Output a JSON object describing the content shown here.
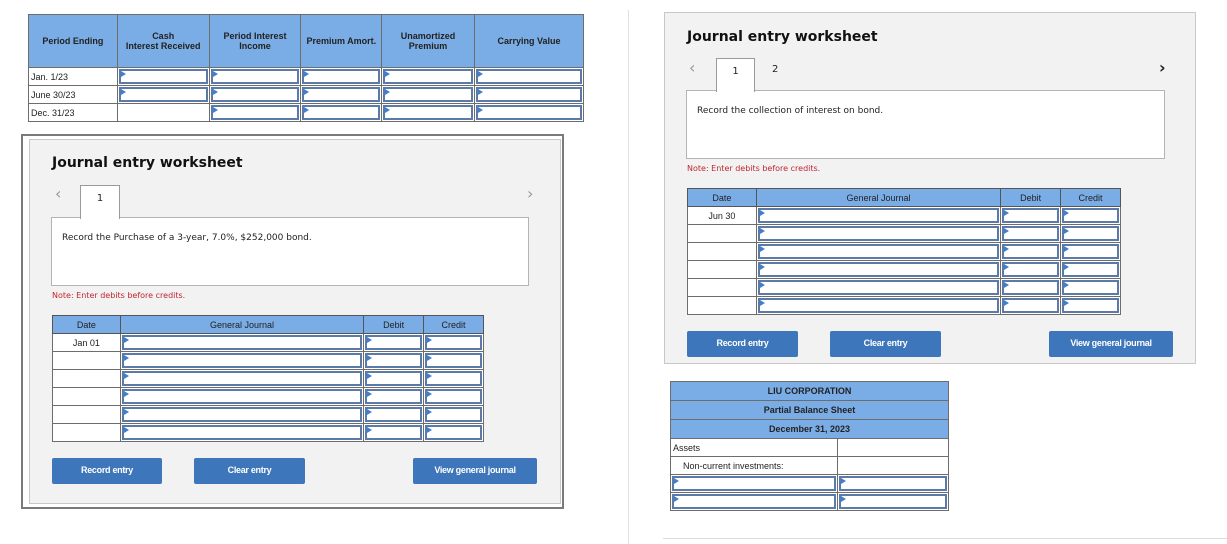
{
  "amortization_table": {
    "headers": [
      "Period Ending",
      "Cash\nInterest Received",
      "Period Interest\nIncome",
      "Premium Amort.",
      "Unamortized\nPremium",
      "Carrying Value"
    ],
    "rows": [
      {
        "period": "Jan. 1/23",
        "cash_input": true,
        "values": [
          "",
          "",
          "",
          "",
          ""
        ]
      },
      {
        "period": "June 30/23",
        "cash_input": true,
        "values": [
          "",
          "",
          "",
          "",
          ""
        ]
      },
      {
        "period": "Dec. 31/23",
        "cash_input": false,
        "values": [
          "",
          "",
          "",
          "",
          ""
        ]
      }
    ]
  },
  "worksheet_left": {
    "title": "Journal entry worksheet",
    "tabs": [
      "1"
    ],
    "active_tab": "1",
    "prompt": "Record the Purchase of a 3-year, 7.0%, $252,000 bond.",
    "note": "Note: Enter debits before credits.",
    "table_headers": [
      "Date",
      "General Journal",
      "Debit",
      "Credit"
    ],
    "rows": [
      {
        "date": "Jan 01",
        "account": "",
        "debit": "",
        "credit": ""
      },
      {
        "date": "",
        "account": "",
        "debit": "",
        "credit": ""
      },
      {
        "date": "",
        "account": "",
        "debit": "",
        "credit": ""
      },
      {
        "date": "",
        "account": "",
        "debit": "",
        "credit": ""
      },
      {
        "date": "",
        "account": "",
        "debit": "",
        "credit": ""
      },
      {
        "date": "",
        "account": "",
        "debit": "",
        "credit": ""
      }
    ],
    "buttons": {
      "record": "Record entry",
      "clear": "Clear entry",
      "view": "View general journal"
    },
    "prev_icon": "‹",
    "next_icon": "›"
  },
  "worksheet_right": {
    "title": "Journal entry worksheet",
    "tabs": [
      "1",
      "2"
    ],
    "active_tab": "1",
    "prompt": "Record the collection of interest on bond.",
    "note": "Note: Enter debits before credits.",
    "table_headers": [
      "Date",
      "General Journal",
      "Debit",
      "Credit"
    ],
    "rows": [
      {
        "date": "Jun 30",
        "account": "",
        "debit": "",
        "credit": ""
      },
      {
        "date": "",
        "account": "",
        "debit": "",
        "credit": ""
      },
      {
        "date": "",
        "account": "",
        "debit": "",
        "credit": ""
      },
      {
        "date": "",
        "account": "",
        "debit": "",
        "credit": ""
      },
      {
        "date": "",
        "account": "",
        "debit": "",
        "credit": ""
      },
      {
        "date": "",
        "account": "",
        "debit": "",
        "credit": ""
      }
    ],
    "buttons": {
      "record": "Record entry",
      "clear": "Clear entry",
      "view": "View general journal"
    },
    "prev_icon": "‹",
    "next_icon": "›"
  },
  "balance_sheet": {
    "company": "LIU CORPORATION",
    "statement": "Partial Balance Sheet",
    "date": "December 31, 2023",
    "section": "Assets",
    "subsection": "Non-current investments:",
    "input_rows": [
      {
        "label": "",
        "amount": ""
      },
      {
        "label": "",
        "amount": ""
      }
    ]
  }
}
